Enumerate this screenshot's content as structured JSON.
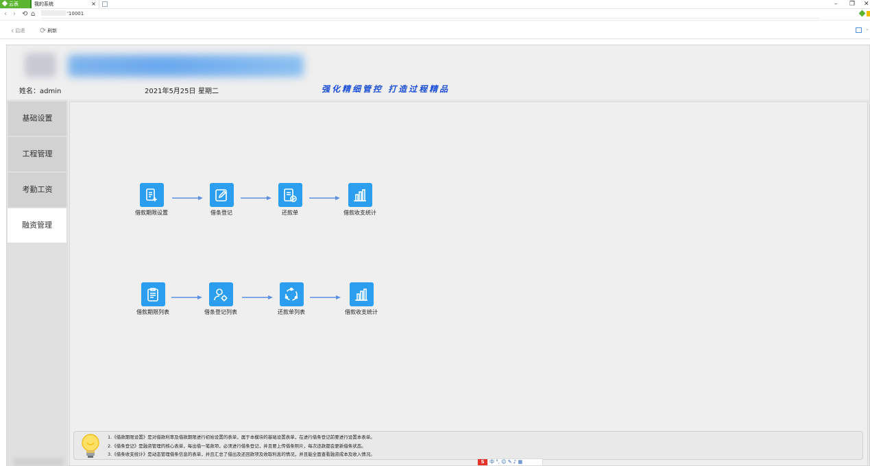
{
  "browser": {
    "cloud_tab": "云表",
    "active_tab": "我的系统",
    "tab_close": "×",
    "address_suffix": "'10001",
    "window_min": "–",
    "window_restore": "❐",
    "window_close": "✕"
  },
  "toolbar": {
    "back_label": "后退",
    "refresh_label": "刷新"
  },
  "header": {
    "user_label": "姓名：admin",
    "date": "2021年5月25日",
    "weekday": "星期二",
    "slogan": "强化精细管控   打造过程精品"
  },
  "sidebar": {
    "items": [
      {
        "label": "基础设置"
      },
      {
        "label": "工程管理"
      },
      {
        "label": "考勤工资"
      },
      {
        "label": "融资管理"
      }
    ],
    "active_index": 3
  },
  "flow_top": [
    {
      "label": "借款期限设置",
      "icon": "doc-plus-icon"
    },
    {
      "label": "借条登记",
      "icon": "edit-icon"
    },
    {
      "label": "还款单",
      "icon": "doc-check-icon"
    },
    {
      "label": "借款收支统计",
      "icon": "bar-chart-icon"
    }
  ],
  "flow_bottom": [
    {
      "label": "借款期限列表",
      "icon": "clipboard-icon"
    },
    {
      "label": "借条登记列表",
      "icon": "user-gear-icon"
    },
    {
      "label": "还款单列表",
      "icon": "cycle-icon"
    },
    {
      "label": "借款收支统计",
      "icon": "bar-chart-icon"
    }
  ],
  "notes": [
    "1.《借款期限设置》是对借款利率及借款期限进行初始设置的表单，属于本模块的基础设置表单，在进行借条登记前要进行设置本表单。",
    "2.《借条登记》是融资管理的核心表单，每出借一笔款项，必须进行借条登记，并且要上传借条照片，每次还款都会更新借条状态。",
    "3.《借条收支统计》是动态管理借条信息的表单，并且汇总了借出及还回款项及收取利息的情况，并且能全面查看融资成本及收入情况。"
  ],
  "ime": {
    "logo": "S",
    "items": "中 °, ☺ ✎ ♪ ▦"
  },
  "colors": {
    "accent": "#2b9ef0",
    "slogan": "#1a4ed8",
    "brand_green": "#5cb531"
  }
}
